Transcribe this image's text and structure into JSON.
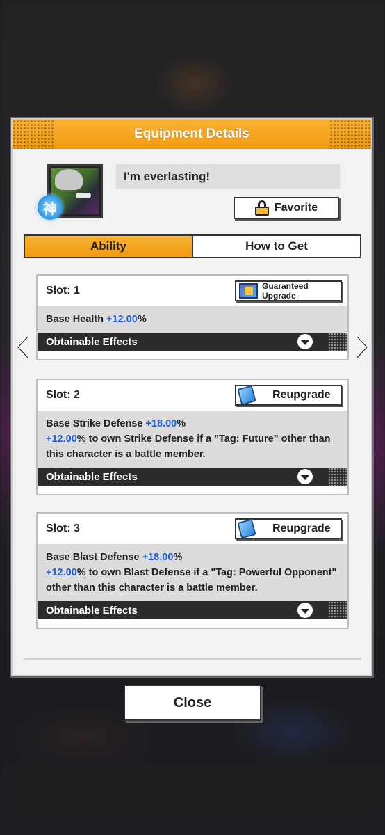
{
  "dialog": {
    "title": "Equipment Details",
    "equipment_name": "I'm everlasting!",
    "portrait_badge": "神",
    "favorite_label": "Favorite"
  },
  "tabs": [
    {
      "label": "Ability",
      "active": true
    },
    {
      "label": "How to Get",
      "active": false
    }
  ],
  "slots": [
    {
      "title": "Slot: 1",
      "button_label": "Guaranteed Upgrade",
      "button_icon": "ticket-icon",
      "line1_prefix": "Base Health ",
      "line1_value": "+12.00",
      "line1_suffix": "%",
      "line2_value": "",
      "line2_text": "",
      "effects_label": "Obtainable Effects"
    },
    {
      "title": "Slot: 2",
      "button_label": "Reupgrade",
      "button_icon": "card-icon",
      "line1_prefix": "Base Strike Defense ",
      "line1_value": "+18.00",
      "line1_suffix": "%",
      "line2_value": "+12.00",
      "line2_text": "% to own Strike Defense if a \"Tag: Future\" other than this character is a battle member.",
      "effects_label": "Obtainable Effects"
    },
    {
      "title": "Slot: 3",
      "button_label": "Reupgrade",
      "button_icon": "card-icon",
      "line1_prefix": "Base Blast Defense ",
      "line1_value": "+18.00",
      "line1_suffix": "%",
      "line2_value": "+12.00",
      "line2_text": "% to own Blast Defense if a \"Tag: Powerful Opponent\" other than this character is a battle member.",
      "effects_label": "Obtainable Effects"
    }
  ],
  "close_label": "Close",
  "colors": {
    "accent": "#f29a12",
    "value_blue": "#1f5fd6"
  }
}
